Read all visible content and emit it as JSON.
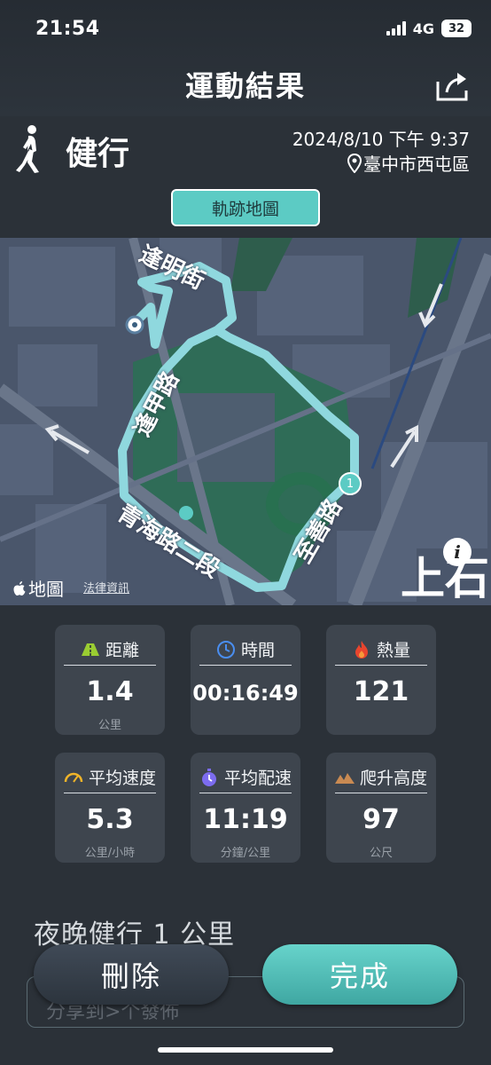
{
  "status_bar": {
    "time": "21:54",
    "network": "4G",
    "battery": "32"
  },
  "header": {
    "title": "運動結果"
  },
  "activity": {
    "name": "健行",
    "datetime": "2024/8/10 下午 9:37",
    "location": "臺中市西屯區"
  },
  "map_tab": {
    "label": "軌跡地圖"
  },
  "map": {
    "road_labels": [
      "逢明街",
      "逢甲路",
      "青海路二段",
      "至善路"
    ],
    "corner_label": "上石",
    "marker_label": "1",
    "attribution": {
      "logo": "地圖",
      "legal": "法律資訊"
    },
    "route_color": "#8fd8de"
  },
  "stats": [
    {
      "icon": "road-icon",
      "label": "距離",
      "value": "1.4",
      "unit": "公里"
    },
    {
      "icon": "clock-icon",
      "label": "時間",
      "value": "00:16:49",
      "unit": ""
    },
    {
      "icon": "flame-icon",
      "label": "熱量",
      "value": "121",
      "unit": ""
    },
    {
      "icon": "speedometer-icon",
      "label": "平均速度",
      "value": "5.3",
      "unit": "公里/小時"
    },
    {
      "icon": "stopwatch-icon",
      "label": "平均配速",
      "value": "11:19",
      "unit": "分鐘/公里"
    },
    {
      "icon": "mountain-icon",
      "label": "爬升高度",
      "value": "97",
      "unit": "公尺"
    }
  ],
  "workout_title": "夜晚健行 1 公里",
  "note": {
    "text": "分享到>个發佈"
  },
  "buttons": {
    "delete": "刪除",
    "done": "完成"
  },
  "colors": {
    "accent": "#5ccbc4",
    "background": "#2b3138",
    "card": "#3e454e"
  }
}
